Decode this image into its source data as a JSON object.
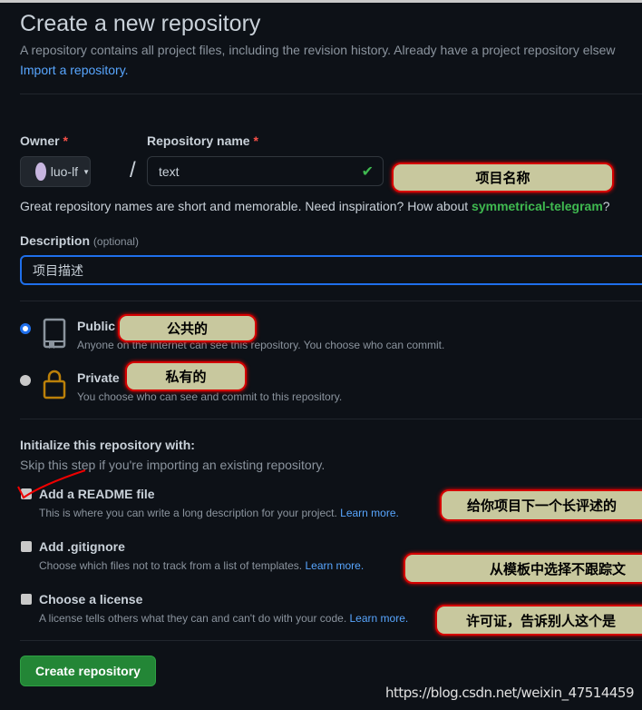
{
  "header": {
    "title": "Create a new repository",
    "description": "A repository contains all project files, including the revision history. Already have a project repository elsew",
    "import_link": "Import a repository."
  },
  "owner": {
    "label": "Owner",
    "required": "*",
    "value": "luo-lf"
  },
  "repo_name": {
    "label": "Repository name",
    "required": "*",
    "value": "text",
    "hint_prefix": "Great repository names are short and memorable. Need inspiration? How about ",
    "suggestion": "symmetrical-telegram",
    "hint_suffix": "?"
  },
  "description": {
    "label": "Description",
    "optional": "(optional)",
    "value": "项目描述"
  },
  "visibility": {
    "public": {
      "label": "Public",
      "desc": "Anyone on the internet can see this repository. You choose who can commit.",
      "selected": true
    },
    "private": {
      "label": "Private",
      "desc": "You choose who can see and commit to this repository.",
      "selected": false
    }
  },
  "init": {
    "heading": "Initialize this repository with:",
    "subtext": "Skip this step if you're importing an existing repository.",
    "options": [
      {
        "label": "Add a README file",
        "desc": "This is where you can write a long description for your project. ",
        "link": "Learn more."
      },
      {
        "label": "Add .gitignore",
        "desc": "Choose which files not to track from a list of templates. ",
        "link": "Learn more."
      },
      {
        "label": "Choose a license",
        "desc": "A license tells others what they can and can't do with your code. ",
        "link": "Learn more."
      }
    ]
  },
  "create_button": "Create repository",
  "annotations": {
    "repo_name": "项目名称",
    "public": "公共的",
    "private": "私有的",
    "readme": "给你项目下一个长评述的",
    "gitignore": "从模板中选择不跟踪文",
    "license": "许可证，告诉别人这个是"
  },
  "watermark": "https://blog.csdn.net/weixin_47514459",
  "colors": {
    "background": "#0d1117",
    "link": "#58a6ff",
    "success": "#3fb950",
    "button": "#238636",
    "annotation_fill": "#c8c89e",
    "annotation_border": "#d40000"
  }
}
